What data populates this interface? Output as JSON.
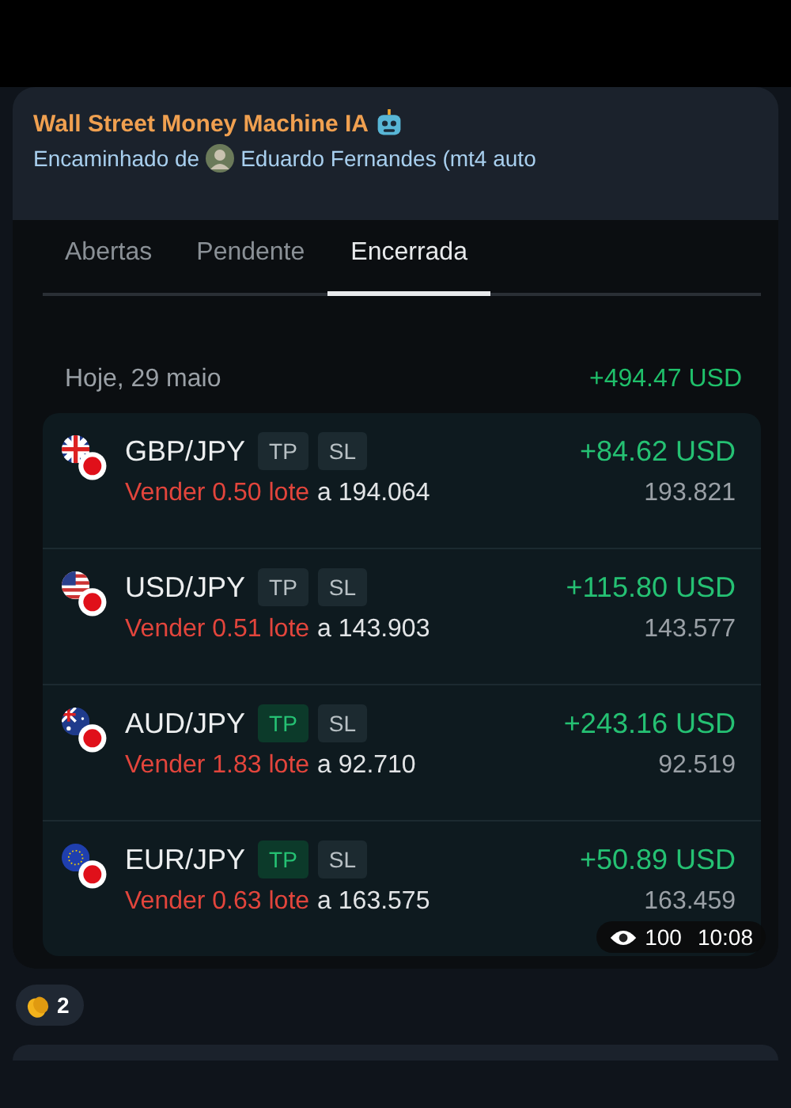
{
  "message": {
    "channel": "Wall Street Money Machine IA",
    "forwarded_label": "Encaminhado de",
    "forwarded_from": "Eduardo Fernandes (mt4 auto"
  },
  "tabs": [
    {
      "label": "Abertas",
      "selected": false
    },
    {
      "label": "Pendente",
      "selected": false
    },
    {
      "label": "Encerrada",
      "selected": true
    }
  ],
  "day": {
    "date": "Hoje, 29 maio",
    "total": "+494.47 USD"
  },
  "trades": [
    {
      "kind": "gb",
      "pair": "GBP/JPY",
      "tp": "TP",
      "tp_hit": false,
      "sl": "SL",
      "profit": "+84.62 USD",
      "side": "Vender 0.50 lote",
      "at": "a 194.064",
      "close": "193.821"
    },
    {
      "kind": "us",
      "pair": "USD/JPY",
      "tp": "TP",
      "tp_hit": false,
      "sl": "SL",
      "profit": "+115.80 USD",
      "side": "Vender 0.51 lote",
      "at": "a 143.903",
      "close": "143.577"
    },
    {
      "kind": "au",
      "pair": "AUD/JPY",
      "tp": "TP",
      "tp_hit": true,
      "sl": "SL",
      "profit": "+243.16 USD",
      "side": "Vender 1.83 lote",
      "at": "a 92.710",
      "close": "92.519"
    },
    {
      "kind": "eu",
      "pair": "EUR/JPY",
      "tp": "TP",
      "tp_hit": true,
      "sl": "SL",
      "profit": "+50.89 USD",
      "side": "Vender 0.63 lote",
      "at": "a 163.575",
      "close": "163.459"
    }
  ],
  "meta": {
    "views": "100",
    "time": "10:08"
  },
  "reaction": {
    "count": "2"
  }
}
